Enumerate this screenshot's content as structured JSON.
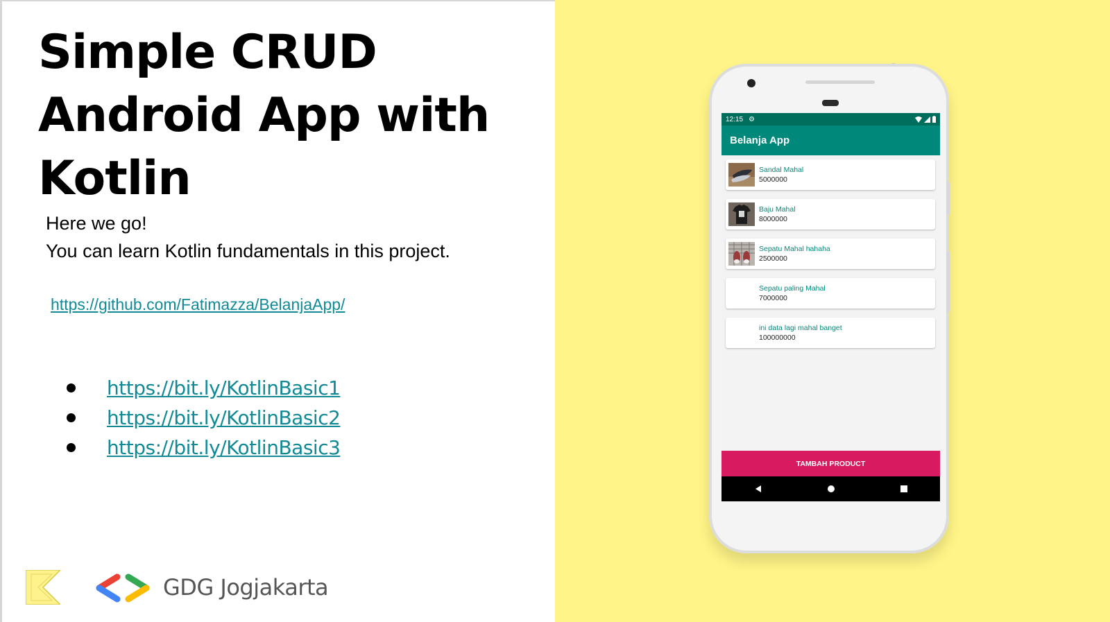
{
  "slide": {
    "title_lines": [
      "Simple CRUD",
      "Android App with",
      "Kotlin"
    ],
    "intro_lines": [
      "Here we go!",
      "You can learn Kotlin fundamentals in this project."
    ],
    "repo_link": "https://github.com/Fatimazza/BelanjaApp/",
    "bullet_links": [
      "https://bit.ly/KotlinBasic1",
      "https://bit.ly/KotlinBasic2",
      "https://bit.ly/KotlinBasic3"
    ],
    "footer_brand": "GDG Jogjakarta",
    "colors": {
      "right_panel": "#fef487",
      "link": "#118a96"
    }
  },
  "phone": {
    "status_time": "12:15",
    "app_title": "Belanja App",
    "products": [
      {
        "name": "Sandal Mahal",
        "price": "5000000",
        "thumb": "sandal-image"
      },
      {
        "name": "Baju Mahal",
        "price": "8000000",
        "thumb": "shirt-image"
      },
      {
        "name": "Sepatu Mahal hahaha",
        "price": "2500000",
        "thumb": "shoes-image"
      },
      {
        "name": "Sepatu paling Mahal",
        "price": "7000000",
        "thumb": ""
      },
      {
        "name": "ini data lagi mahal banget",
        "price": "100000000",
        "thumb": ""
      }
    ],
    "add_button_label": "TAMBAH PRODUCT",
    "colors": {
      "status_bar": "#006e5c",
      "app_bar": "#00897b",
      "button": "#d81b60"
    }
  }
}
